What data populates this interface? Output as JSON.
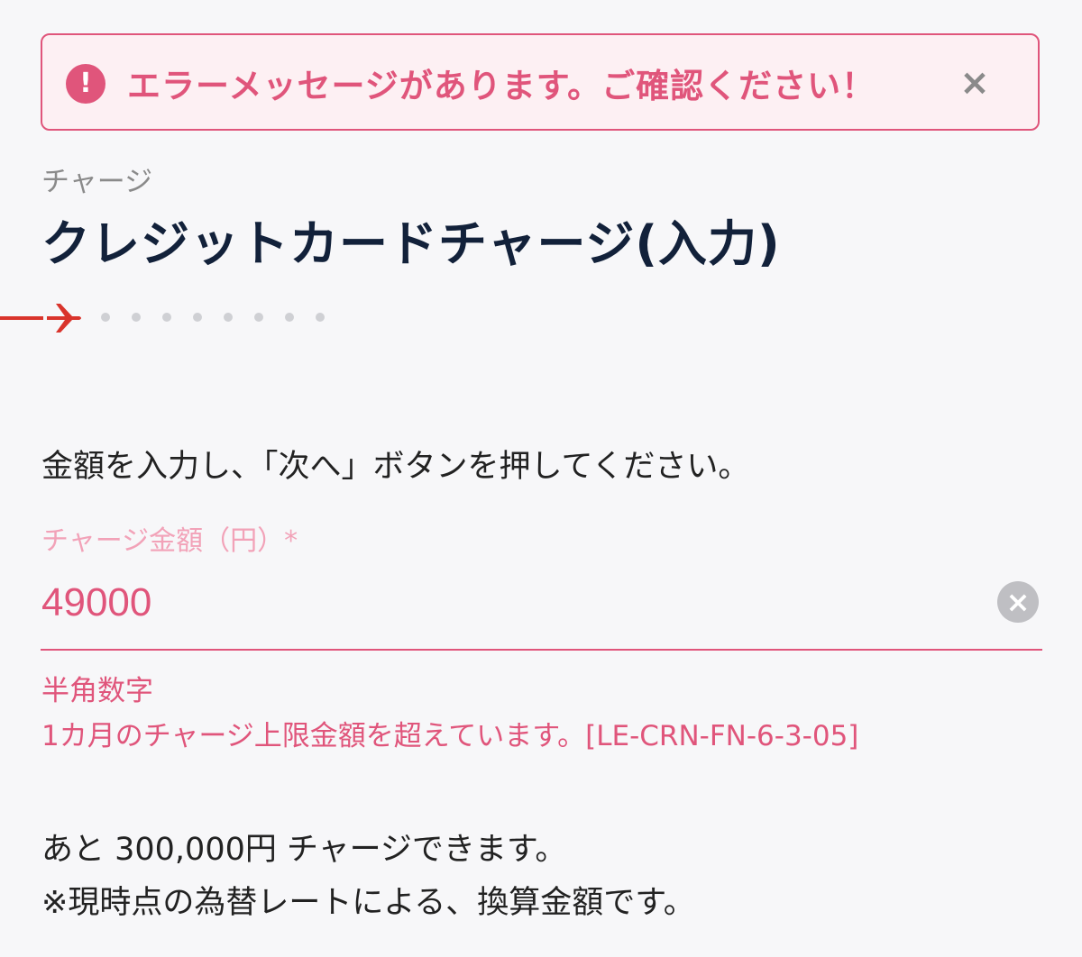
{
  "alert": {
    "icon": "exclamation-icon",
    "icon_glyph": "!",
    "message": "エラーメッセージがあります。ご確認ください！",
    "close_glyph": "×",
    "color": "#e0557b",
    "background": "#fdf0f3"
  },
  "header": {
    "breadcrumb": "チャージ",
    "title": "クレジットカードチャージ(入力)"
  },
  "progress": {
    "current_step": 1,
    "total_steps": 9,
    "icon": "airplane-icon",
    "accent": "#d9342c"
  },
  "form": {
    "instruction": "金額を入力し、「次へ」ボタンを押してください。",
    "amount_label": "チャージ金額（円）*",
    "amount_value": "49000",
    "clear_glyph": "×",
    "hint": "半角数字",
    "error": "1カ月のチャージ上限金額を超えています。[LE-CRN-FN-6-3-05]"
  },
  "info": {
    "remaining": "あと 300,000円 チャージできます。",
    "note": "※現時点の為替レートによる、換算金額です。"
  }
}
